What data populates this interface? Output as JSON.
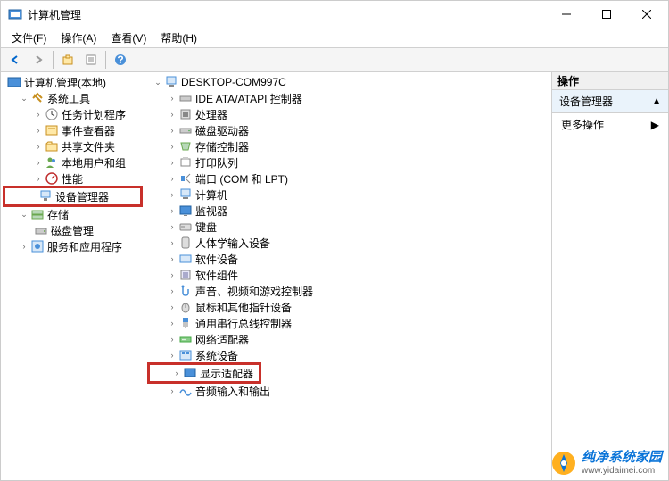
{
  "window": {
    "title": "计算机管理"
  },
  "menu": {
    "file": "文件(F)",
    "action": "操作(A)",
    "view": "查看(V)",
    "help": "帮助(H)"
  },
  "left_tree": {
    "root": "计算机管理(本地)",
    "system_tools": "系统工具",
    "task_scheduler": "任务计划程序",
    "event_viewer": "事件查看器",
    "shared_folders": "共享文件夹",
    "local_users": "本地用户和组",
    "performance": "性能",
    "device_manager": "设备管理器",
    "storage": "存储",
    "disk_mgmt": "磁盘管理",
    "services_apps": "服务和应用程序"
  },
  "mid_tree": {
    "root": "DESKTOP-COM997C",
    "items": [
      "IDE ATA/ATAPI 控制器",
      "处理器",
      "磁盘驱动器",
      "存储控制器",
      "打印队列",
      "端口 (COM 和 LPT)",
      "计算机",
      "监视器",
      "键盘",
      "人体学输入设备",
      "软件设备",
      "软件组件",
      "声音、视频和游戏控制器",
      "鼠标和其他指针设备",
      "通用串行总线控制器",
      "网络适配器",
      "系统设备",
      "显示适配器",
      "音频输入和输出"
    ]
  },
  "right": {
    "header": "操作",
    "sub": "设备管理器",
    "more": "更多操作"
  },
  "watermark": {
    "main": "纯净系统家园",
    "url": "www.yidaimei.com"
  }
}
